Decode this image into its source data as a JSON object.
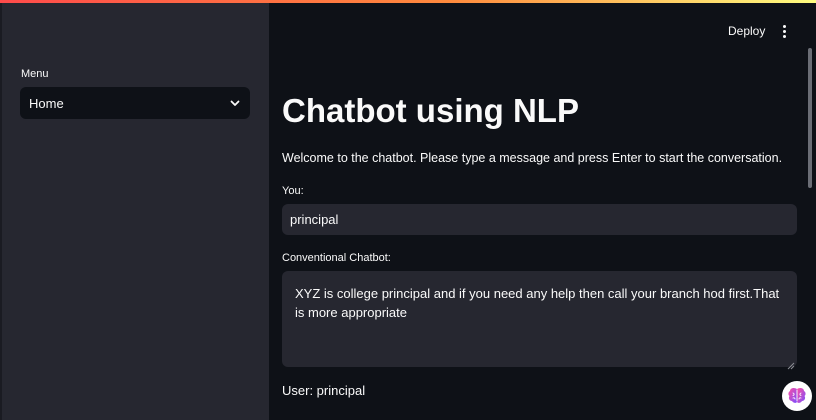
{
  "header": {
    "deploy_label": "Deploy",
    "menu_icon": "kebab-vertical-icon"
  },
  "sidebar": {
    "menu_label": "Menu",
    "select_value": "Home",
    "select_icon": "chevron-down-icon"
  },
  "main": {
    "title": "Chatbot using NLP",
    "welcome": "Welcome to the chatbot. Please type a message and press Enter to start the conversation.",
    "you_label": "You:",
    "you_value": "principal",
    "bot_label": "Conventional Chatbot:",
    "bot_value": "XYZ is college principal and if you need any help then call your branch hod first.That is more appropriate",
    "user_line": "User: principal"
  },
  "colors": {
    "background": "#0e1117",
    "sidebar": "#262730",
    "input": "#262730",
    "accent_start": "#ff4b4b",
    "accent_end": "#fffd80"
  },
  "assistant_icon": "brain-icon"
}
